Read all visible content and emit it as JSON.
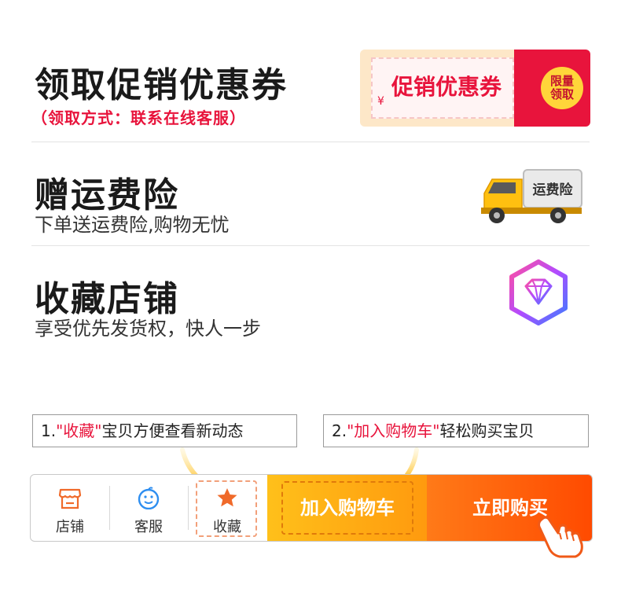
{
  "coupon_section": {
    "title": "领取促销优惠券",
    "subtitle": "（领取方式：联系在线客服）",
    "coupon_label": "促销优惠券",
    "currency_symbol": "¥",
    "badge_line1": "限量",
    "badge_line2": "领取"
  },
  "insurance_section": {
    "title": "赠运费险",
    "subtitle": "下单送运费险,购物无忧",
    "truck_label": "运费险"
  },
  "favorite_section": {
    "title": "收藏店铺",
    "subtitle": "享受优先发货权，快人一步"
  },
  "tips": {
    "tip1_prefix": "1.",
    "tip1_highlight": "\"收藏\"",
    "tip1_suffix": "宝贝方便查看新动态",
    "tip2_prefix": "2.",
    "tip2_highlight": "\"加入购物车\"",
    "tip2_suffix": "轻松购买宝贝"
  },
  "bottom_bar": {
    "store_label": "店铺",
    "service_label": "客服",
    "favorite_label": "收藏",
    "cart_label": "加入购物车",
    "buy_label": "立即购买"
  },
  "colors": {
    "accent_red": "#e8143c",
    "cart_orange": "#ffb014",
    "buy_orange": "#ff5a0a",
    "icon_orange": "#f06a2a",
    "icon_blue": "#2e8ef0"
  },
  "icons": [
    "store-icon",
    "service-icon",
    "star-icon",
    "truck-icon",
    "diamond-icon",
    "hand-pointer-icon",
    "arrow-icon"
  ]
}
